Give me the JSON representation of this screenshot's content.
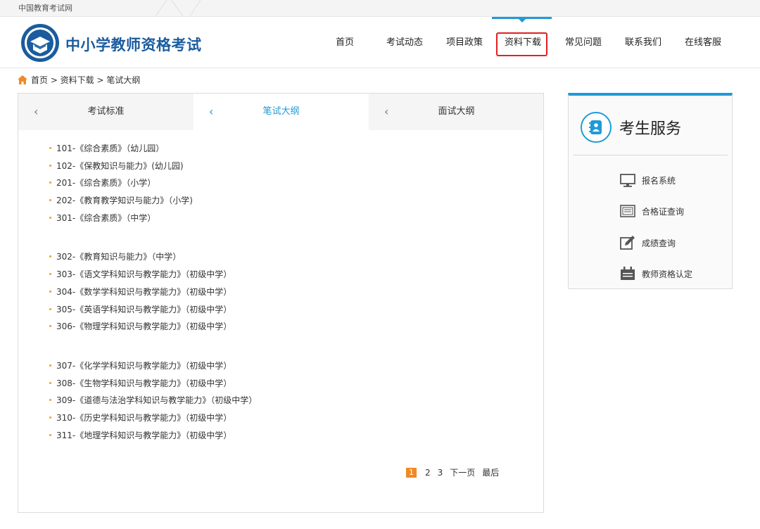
{
  "topbar": {
    "site_name": "中国教育考试网"
  },
  "header": {
    "brand": "中小学教师资格考试",
    "nav": [
      {
        "label": "首页"
      },
      {
        "label": "考试动态"
      },
      {
        "label": "项目政策"
      },
      {
        "label": "资料下载"
      },
      {
        "label": "常见问题"
      },
      {
        "label": "联系我们"
      },
      {
        "label": "在线客服"
      }
    ],
    "active_nav": "资料下载",
    "accent_color": "#1e9bd7"
  },
  "breadcrumb": {
    "text": "首页 > 资料下载 > 笔试大纲"
  },
  "tabs": [
    {
      "label": "考试标准"
    },
    {
      "label": "笔试大纲"
    },
    {
      "label": "面试大纲"
    }
  ],
  "active_tab": "笔试大纲",
  "syllabus": {
    "group1": [
      "101-《综合素质》（幼儿园）",
      "102-《保教知识与能力》(幼儿园)",
      "201-《综合素质》（小学）",
      "202-《教育教学知识与能力》（小学)",
      "301-《综合素质》（中学）"
    ],
    "group2": [
      "302-《教育知识与能力》（中学）",
      "303-《语文学科知识与教学能力》（初级中学）",
      "304-《数学学科知识与教学能力》（初级中学）",
      "305-《英语学科知识与教学能力》（初级中学）",
      "306-《物理学科知识与教学能力》（初级中学）"
    ],
    "group3": [
      "307-《化学学科知识与教学能力》（初级中学）",
      "308-《生物学科知识与教学能力》（初级中学）",
      "309-《道德与法治学科知识与教学能力》（初级中学）",
      "310-《历史学科知识与教学能力》（初级中学）",
      "311-《地理学科知识与教学能力》（初级中学）"
    ]
  },
  "pager": {
    "pages": [
      "1",
      "2",
      "3"
    ],
    "current": "1",
    "next": "下一页",
    "last": "最后"
  },
  "side": {
    "title": "考生服务",
    "items": [
      {
        "label": "报名系统",
        "icon": "monitor-icon"
      },
      {
        "label": "合格证查询",
        "icon": "certificate-icon"
      },
      {
        "label": "成绩查询",
        "icon": "edit-icon"
      },
      {
        "label": "教师资格认定",
        "icon": "calendar-icon"
      }
    ]
  }
}
